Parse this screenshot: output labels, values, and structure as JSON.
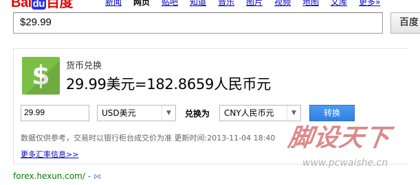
{
  "logo": {
    "part1": "Bai",
    "part2": "du",
    "part3": "百度"
  },
  "nav": [
    "新闻",
    "网页",
    "贴吧",
    "知道",
    "音乐",
    "图片",
    "视频",
    "地图",
    "文库",
    "更多»"
  ],
  "search": {
    "value": "$29.99",
    "button": "百度"
  },
  "card": {
    "icon": "dollar-sign-icon",
    "icon_color": "#7cbf47",
    "title": "货币兑换",
    "result": "29.99美元=182.8659人民币元",
    "amount": "29.99",
    "from_currency": "USD美元",
    "convert_to_label": "兑换为",
    "to_currency": "CNY人民币元",
    "convert_button": "转换",
    "disclaimer": "数据仅供参考，交易时以银行柜台成交价为准 更新时间:2013-11-04 18:40",
    "more_link": "更多汇率信息>>"
  },
  "source": {
    "url": "forex.hexun.com/",
    "sep": " - "
  },
  "watermark": {
    "big": "脚设天下",
    "url": "www.pcwaishe.cn"
  }
}
